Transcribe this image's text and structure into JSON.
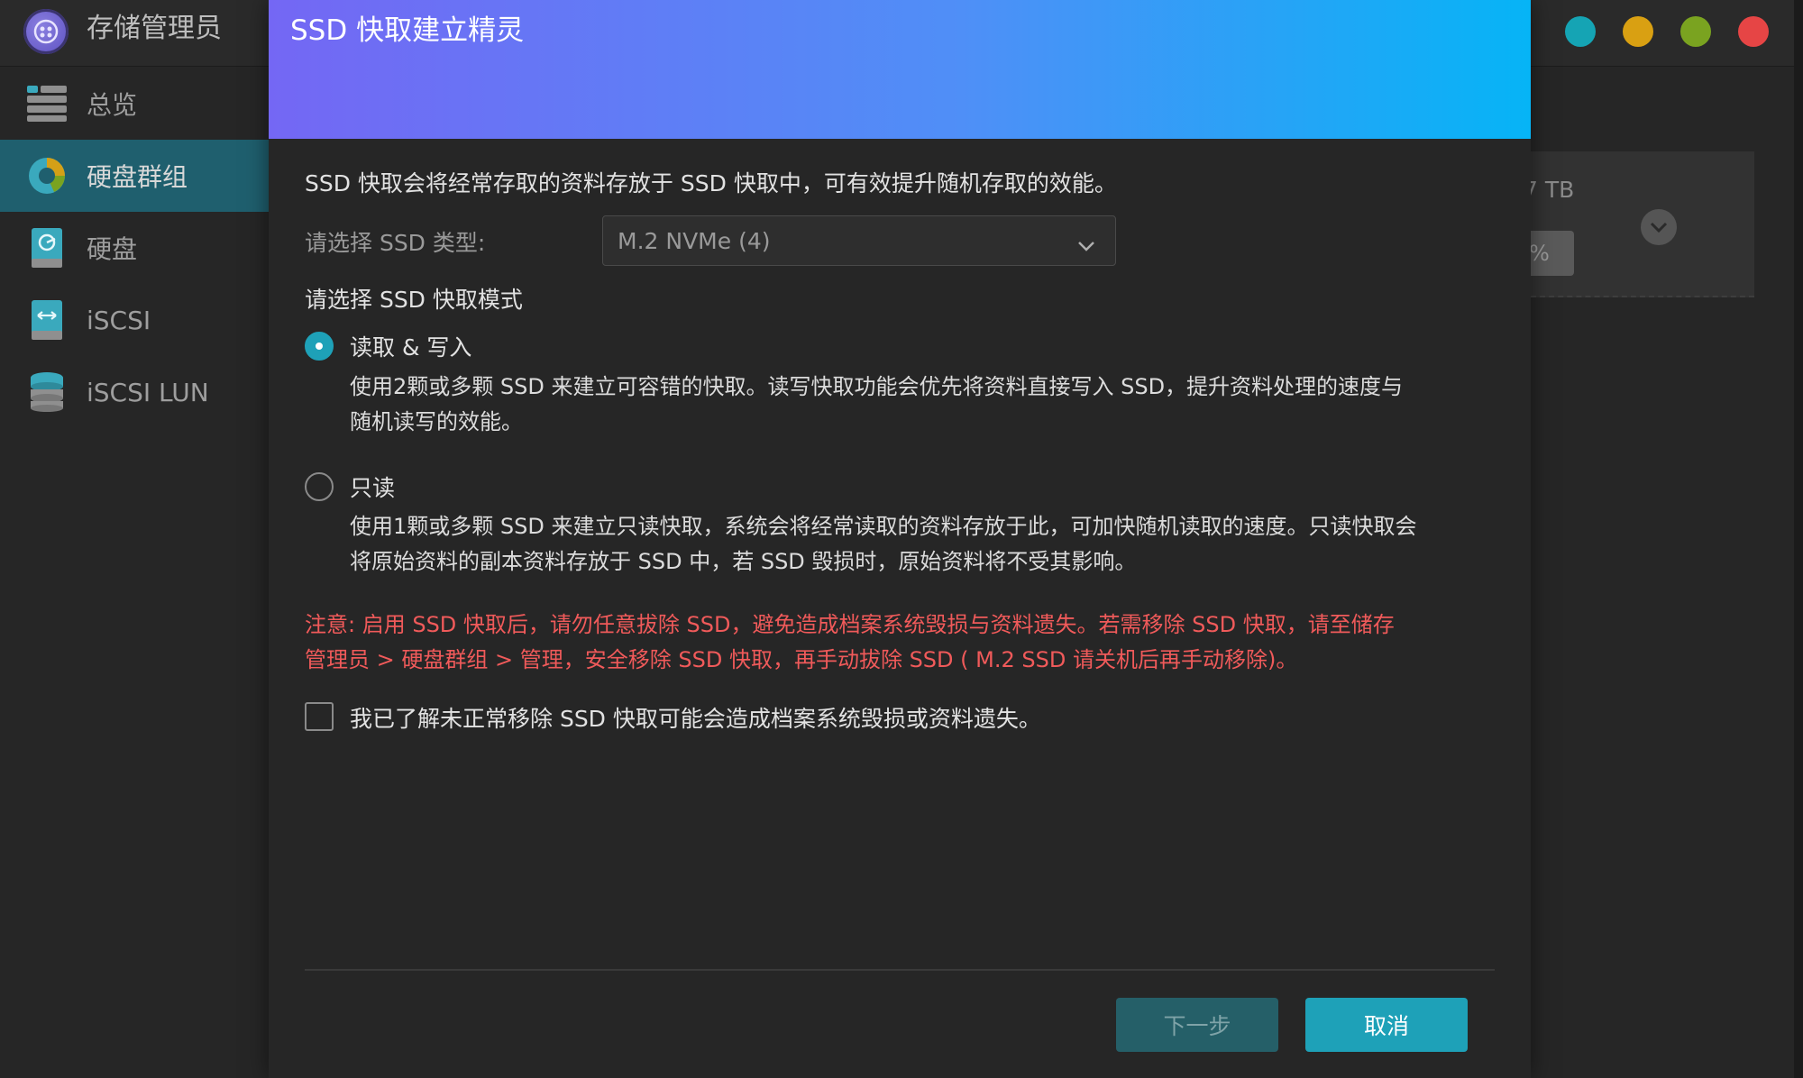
{
  "app": {
    "title": "存储管理员",
    "window_controls": [
      {
        "name": "teal-window-dot",
        "color": "#15a4b4"
      },
      {
        "name": "yellow-window-dot",
        "color": "#d9a012"
      },
      {
        "name": "green-window-dot",
        "color": "#7aa320"
      },
      {
        "name": "red-window-dot",
        "color": "#e64545"
      }
    ]
  },
  "sidebar": {
    "items": [
      {
        "label": "总览",
        "icon": "overview-icon",
        "active": false
      },
      {
        "label": "硬盘群组",
        "icon": "disk-group-icon",
        "active": true
      },
      {
        "label": "硬盘",
        "icon": "disk-icon",
        "active": false
      },
      {
        "label": "iSCSI",
        "icon": "iscsi-icon",
        "active": false
      },
      {
        "label": "iSCSI LUN",
        "icon": "iscsi-lun-icon",
        "active": false
      }
    ]
  },
  "background_card": {
    "capacity_text": "7 TB",
    "percent_text": "%"
  },
  "modal": {
    "title": "SSD 快取建立精灵",
    "intro": "SSD 快取会将经常存取的资料存放于 SSD 快取中，可有效提升随机存取的效能。",
    "type_label": "请选择 SSD 类型:",
    "type_value": "M.2 NVMe (4)",
    "mode_label": "请选择 SSD 快取模式",
    "options": [
      {
        "label": "读取 & 写入",
        "checked": true,
        "desc_line1": "使用2颗或多颗 SSD 来建立可容错的快取。读写快取功能会优先将资料直接写入 SSD，提升资料处理的速度与",
        "desc_line2": "随机读写的效能。"
      },
      {
        "label": "只读",
        "checked": false,
        "desc_line1": "使用1颗或多颗 SSD 来建立只读快取，系统会将经常读取的资料存放于此，可加快随机读取的速度。只读快取会",
        "desc_line2": "将原始资料的副本资料存放于 SSD 中，若 SSD 毁损时，原始资料将不受其影响。"
      }
    ],
    "notice_line1": "注意: 启用 SSD 快取后，请勿任意拔除 SSD，避免造成档案系统毁损与资料遗失。若需移除 SSD 快取，请至储存",
    "notice_line2": "管理员 > 硬盘群组 > 管理，安全移除 SSD 快取，再手动拔除 SSD ( M.2 SSD 请关机后再手动移除)。",
    "acknowledge": {
      "label": "我已了解未正常移除 SSD 快取可能会造成档案系统毁损或资料遗失。",
      "checked": false
    },
    "buttons": {
      "next": "下一步",
      "cancel": "取消"
    }
  }
}
